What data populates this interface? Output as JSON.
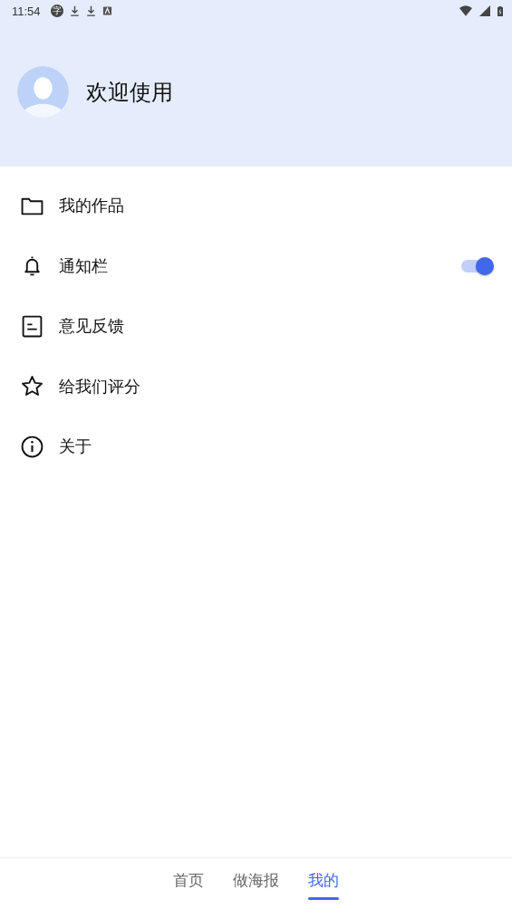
{
  "status_bar": {
    "time": "11:54",
    "badge": "字"
  },
  "header": {
    "title": "欢迎使用"
  },
  "menu": [
    {
      "label": "我的作品",
      "kind": "link"
    },
    {
      "label": "通知栏",
      "kind": "toggle",
      "on": true
    },
    {
      "label": "意见反馈",
      "kind": "link"
    },
    {
      "label": "给我们评分",
      "kind": "link"
    },
    {
      "label": "关于",
      "kind": "link"
    }
  ],
  "tabs": [
    {
      "label": "首页",
      "selected": false
    },
    {
      "label": "做海报",
      "selected": false
    },
    {
      "label": "我的",
      "selected": true
    }
  ]
}
